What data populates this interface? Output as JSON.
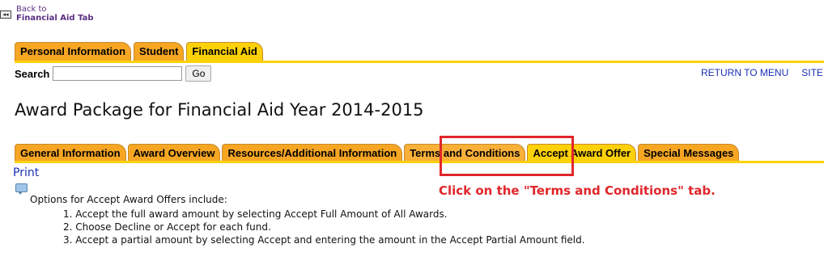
{
  "back": {
    "arrow": "◂◂",
    "line1": "Back to",
    "line2": "Financial Aid Tab"
  },
  "main_tabs": [
    {
      "label": "Personal Information"
    },
    {
      "label": "Student"
    },
    {
      "label": "Financial Aid"
    }
  ],
  "search": {
    "label": "Search",
    "value": "",
    "go_label": "Go"
  },
  "top_links": {
    "return_to_menu": "RETURN TO MENU",
    "site": "SITE"
  },
  "page_title": "Award Package for Financial Aid Year 2014-2015",
  "sub_tabs": [
    {
      "label": "General Information"
    },
    {
      "label": "Award Overview"
    },
    {
      "label": "Resources/Additional Information"
    },
    {
      "label": "Terms and Conditions"
    },
    {
      "label": "Accept Award Offer"
    },
    {
      "label": "Special Messages"
    }
  ],
  "print_label": "Print",
  "instruction": "Click on the \"Terms and Conditions\" tab.",
  "options": {
    "intro": "Options for Accept Award Offers include:",
    "items": [
      "1. Accept the full award amount by selecting Accept Full Amount of All Awards.",
      "2. Choose Decline or Accept for each fund.",
      "3. Accept a partial amount by selecting Accept and entering the amount in the Accept Partial Amount field."
    ]
  },
  "colors": {
    "tab_orange": "#f6a623",
    "tab_yellow": "#fdd10a",
    "link_blue": "#1a2fb5",
    "highlight_red": "#e0262a"
  }
}
